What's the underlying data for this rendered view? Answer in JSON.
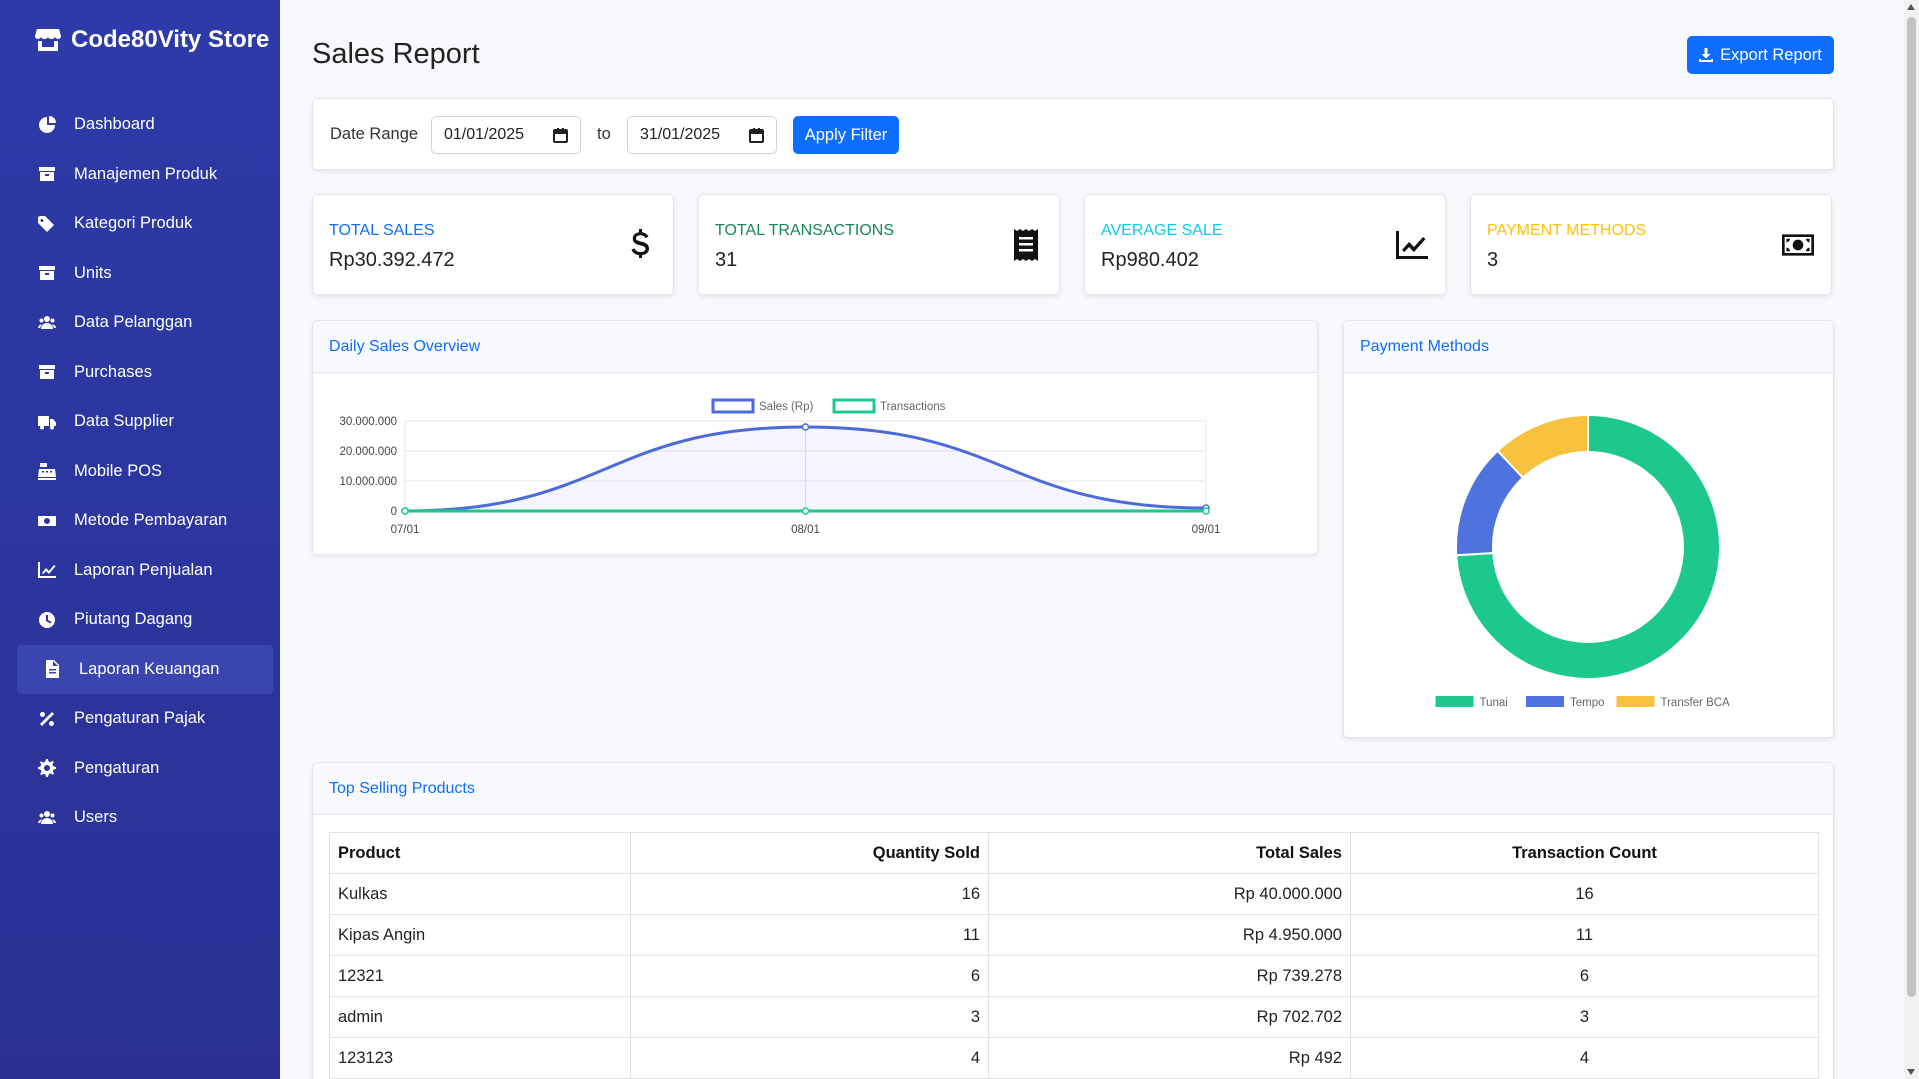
{
  "brand": {
    "name": "Code80Vity Store",
    "icon": "store-icon"
  },
  "sidebar": {
    "items": [
      {
        "label": "Dashboard",
        "icon": "dashboard-icon"
      },
      {
        "label": "Manajemen Produk",
        "icon": "box-icon"
      },
      {
        "label": "Kategori Produk",
        "icon": "tag-icon"
      },
      {
        "label": "Units",
        "icon": "box-icon"
      },
      {
        "label": "Data Pelanggan",
        "icon": "users-icon"
      },
      {
        "label": "Purchases",
        "icon": "box-icon"
      },
      {
        "label": "Data Supplier",
        "icon": "truck-icon"
      },
      {
        "label": "Mobile POS",
        "icon": "cash-register-icon"
      },
      {
        "label": "Metode Pembayaran",
        "icon": "money-icon"
      },
      {
        "label": "Laporan Penjualan",
        "icon": "chart-line-icon"
      },
      {
        "label": "Piutang Dagang",
        "icon": "clock-icon"
      },
      {
        "label": "Laporan Keuangan",
        "icon": "file-icon",
        "active": true
      },
      {
        "label": "Pengaturan Pajak",
        "icon": "percent-icon"
      },
      {
        "label": "Pengaturan",
        "icon": "gear-icon"
      },
      {
        "label": "Users",
        "icon": "users-icon"
      }
    ]
  },
  "header": {
    "title": "Sales Report",
    "export_label": "Export Report"
  },
  "filter": {
    "label": "Date Range",
    "from": "01/01/2025",
    "to_label": "to",
    "to": "31/01/2025",
    "apply_label": "Apply Filter"
  },
  "stats": [
    {
      "label": "Total Sales",
      "value": "Rp30.392.472",
      "color": "#0d6efd",
      "icon": "dollar-icon"
    },
    {
      "label": "Total Transactions",
      "value": "31",
      "color": "#198754",
      "icon": "receipt-icon"
    },
    {
      "label": "Average Sale",
      "value": "Rp980.402",
      "color": "#0dcaf0",
      "icon": "chart-line-icon"
    },
    {
      "label": "Payment Methods",
      "value": "3",
      "color": "#ffc107",
      "icon": "money-bill-icon"
    }
  ],
  "daily_chart": {
    "title": "Daily Sales Overview"
  },
  "payment_chart": {
    "title": "Payment Methods"
  },
  "chart_data": [
    {
      "type": "line",
      "title": "",
      "x": [
        "07/01",
        "08/01",
        "09/01"
      ],
      "series": [
        {
          "name": "Sales (Rp)",
          "values": [
            0,
            28000000,
            1000000
          ],
          "color": "#4e6ad9"
        },
        {
          "name": "Transactions",
          "values": [
            0,
            0,
            0
          ],
          "color": "#1cc88a"
        }
      ],
      "yticks": [
        "0",
        "10.000.000",
        "20.000.000",
        "30.000.000"
      ],
      "ylim": [
        0,
        30000000
      ],
      "legend": "top"
    },
    {
      "type": "pie",
      "title": "",
      "labels": [
        "Tunai",
        "Tempo",
        "Transfer BCA"
      ],
      "values": [
        74,
        14,
        12
      ],
      "colors": [
        "#1cc88a",
        "#4e73df",
        "#f6c23e"
      ],
      "legend": "bottom"
    }
  ],
  "top_products": {
    "title": "Top Selling Products",
    "columns": [
      "Product",
      "Quantity Sold",
      "Total Sales",
      "Transaction Count"
    ],
    "rows": [
      [
        "Kulkas",
        "16",
        "Rp 40.000.000",
        "16"
      ],
      [
        "Kipas Angin",
        "11",
        "Rp 4.950.000",
        "11"
      ],
      [
        "12321",
        "6",
        "Rp 739.278",
        "6"
      ],
      [
        "admin",
        "3",
        "Rp 702.702",
        "3"
      ],
      [
        "123123",
        "4",
        "Rp 492",
        "4"
      ]
    ]
  }
}
